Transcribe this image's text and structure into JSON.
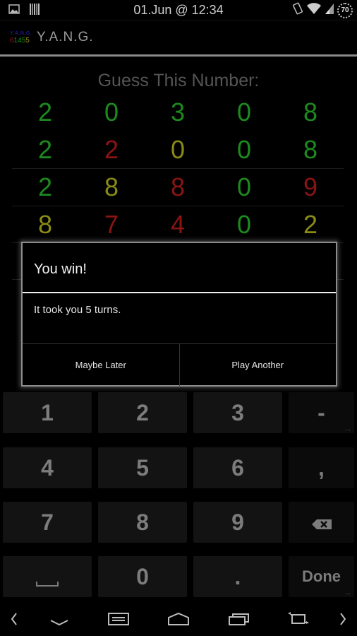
{
  "status_bar": {
    "time": "01.Jun @ 12:34",
    "battery_level": "70",
    "left_icons": [
      "image-notification-icon",
      "barcode-notification-icon"
    ],
    "right_icons": [
      "rotate-icon",
      "wifi-icon",
      "cell-signal-icon",
      "battery-icon"
    ]
  },
  "action_bar": {
    "title": "Y.A.N.G.",
    "logo_top": "Y.A.N.G.",
    "logo_digits": [
      "6",
      "1",
      "4",
      "5",
      "5"
    ],
    "logo_digit_colors": [
      "#9a1a1a",
      "#1a8a1a",
      "#1a8a1a",
      "#1a8a1a",
      "#9a8a1a"
    ]
  },
  "game": {
    "label": "Guess This Number:",
    "colors": {
      "correct": "#1d8a1d",
      "misplaced": "#8a8a16",
      "wrong": "#8a1414"
    },
    "target": {
      "digits": [
        "2",
        "0",
        "3",
        "0",
        "8"
      ],
      "states": [
        "correct",
        "correct",
        "correct",
        "correct",
        "correct"
      ]
    },
    "guesses": [
      {
        "digits": [
          "2",
          "2",
          "0",
          "0",
          "8"
        ],
        "states": [
          "correct",
          "wrong",
          "misplaced",
          "correct",
          "correct"
        ]
      },
      {
        "digits": [
          "2",
          "8",
          "8",
          "0",
          "9"
        ],
        "states": [
          "correct",
          "misplaced",
          "wrong",
          "correct",
          "wrong"
        ]
      },
      {
        "digits": [
          "8",
          "7",
          "4",
          "0",
          "2"
        ],
        "states": [
          "misplaced",
          "wrong",
          "wrong",
          "correct",
          "misplaced"
        ]
      }
    ]
  },
  "dialog": {
    "title": "You win!",
    "message": "It took you 5 turns.",
    "negative_button": "Maybe Later",
    "positive_button": "Play Another"
  },
  "keyboard": {
    "rows": [
      [
        "1",
        "2",
        "3",
        "-"
      ],
      [
        "4",
        "5",
        "6",
        ","
      ],
      [
        "7",
        "8",
        "9",
        "backspace"
      ],
      [
        "space",
        "0",
        ".",
        "Done"
      ]
    ],
    "more_hint": "..."
  },
  "nav_bar": {
    "icons": [
      "scroll-left-icon",
      "hide-keyboard-icon",
      "menu-icon",
      "home-icon",
      "recent-apps-icon",
      "rotate-screen-icon",
      "scroll-right-icon"
    ]
  }
}
